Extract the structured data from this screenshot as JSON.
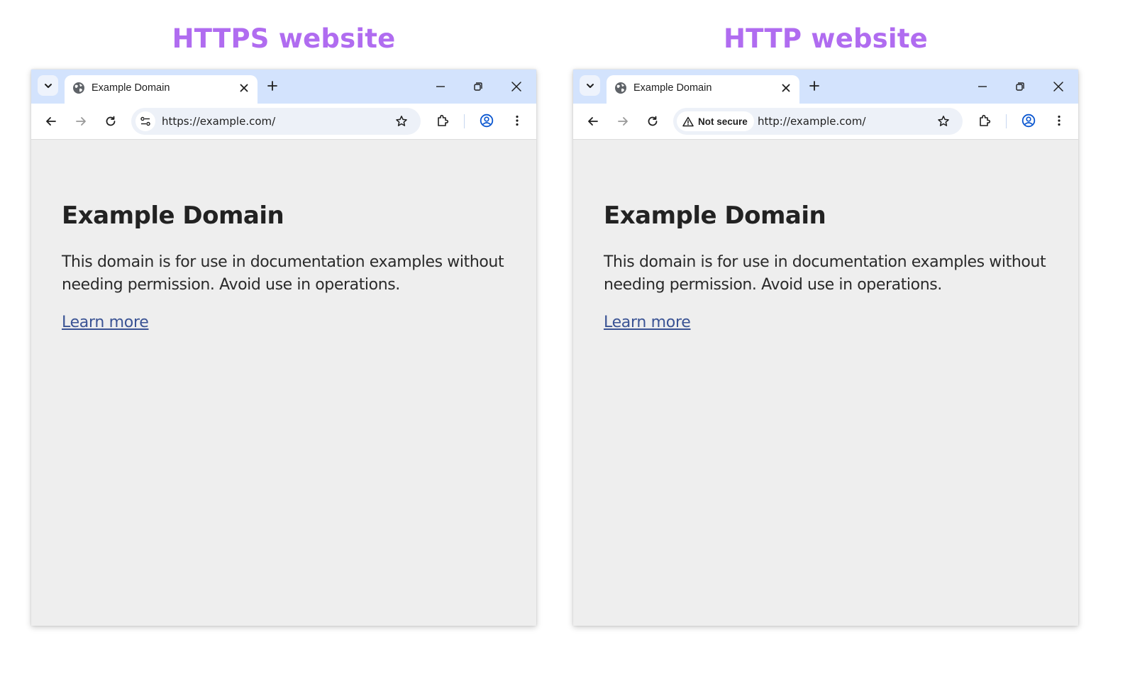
{
  "panels": {
    "left": {
      "heading": "HTTPS website",
      "tab_title": "Example Domain",
      "url": "https://example.com/",
      "page": {
        "title": "Example Domain",
        "description": "This domain is for use in documentation examples without needing permission. Avoid use in operations.",
        "link_text": "Learn more"
      }
    },
    "right": {
      "heading": "HTTP website",
      "tab_title": "Example Domain",
      "security_chip": "Not secure",
      "url": "http://example.com/",
      "page": {
        "title": "Example Domain",
        "description": "This domain is for use in documentation examples without needing permission. Avoid use in operations.",
        "link_text": "Learn more"
      }
    }
  },
  "icons": {
    "tab_search": "chevron-down-icon",
    "favicon": "globe-icon",
    "tab_close": "close-icon",
    "new_tab": "plus-icon",
    "minimize": "minimize-icon",
    "restore": "restore-icon",
    "window_close": "close-icon",
    "back": "arrow-left-icon",
    "forward": "arrow-right-icon",
    "reload": "reload-icon",
    "site_info": "tune-icon",
    "warning": "warning-icon",
    "bookmark": "star-icon",
    "extensions": "puzzle-icon",
    "profile": "profile-icon",
    "menu": "more-vert-icon"
  },
  "colors": {
    "heading": "#b06cf0",
    "tab_strip": "#d3e3fd",
    "omnibox": "#edf1f8",
    "page_background": "#eeeeee",
    "link": "#3a5394",
    "profile_accent": "#0b57d0"
  }
}
